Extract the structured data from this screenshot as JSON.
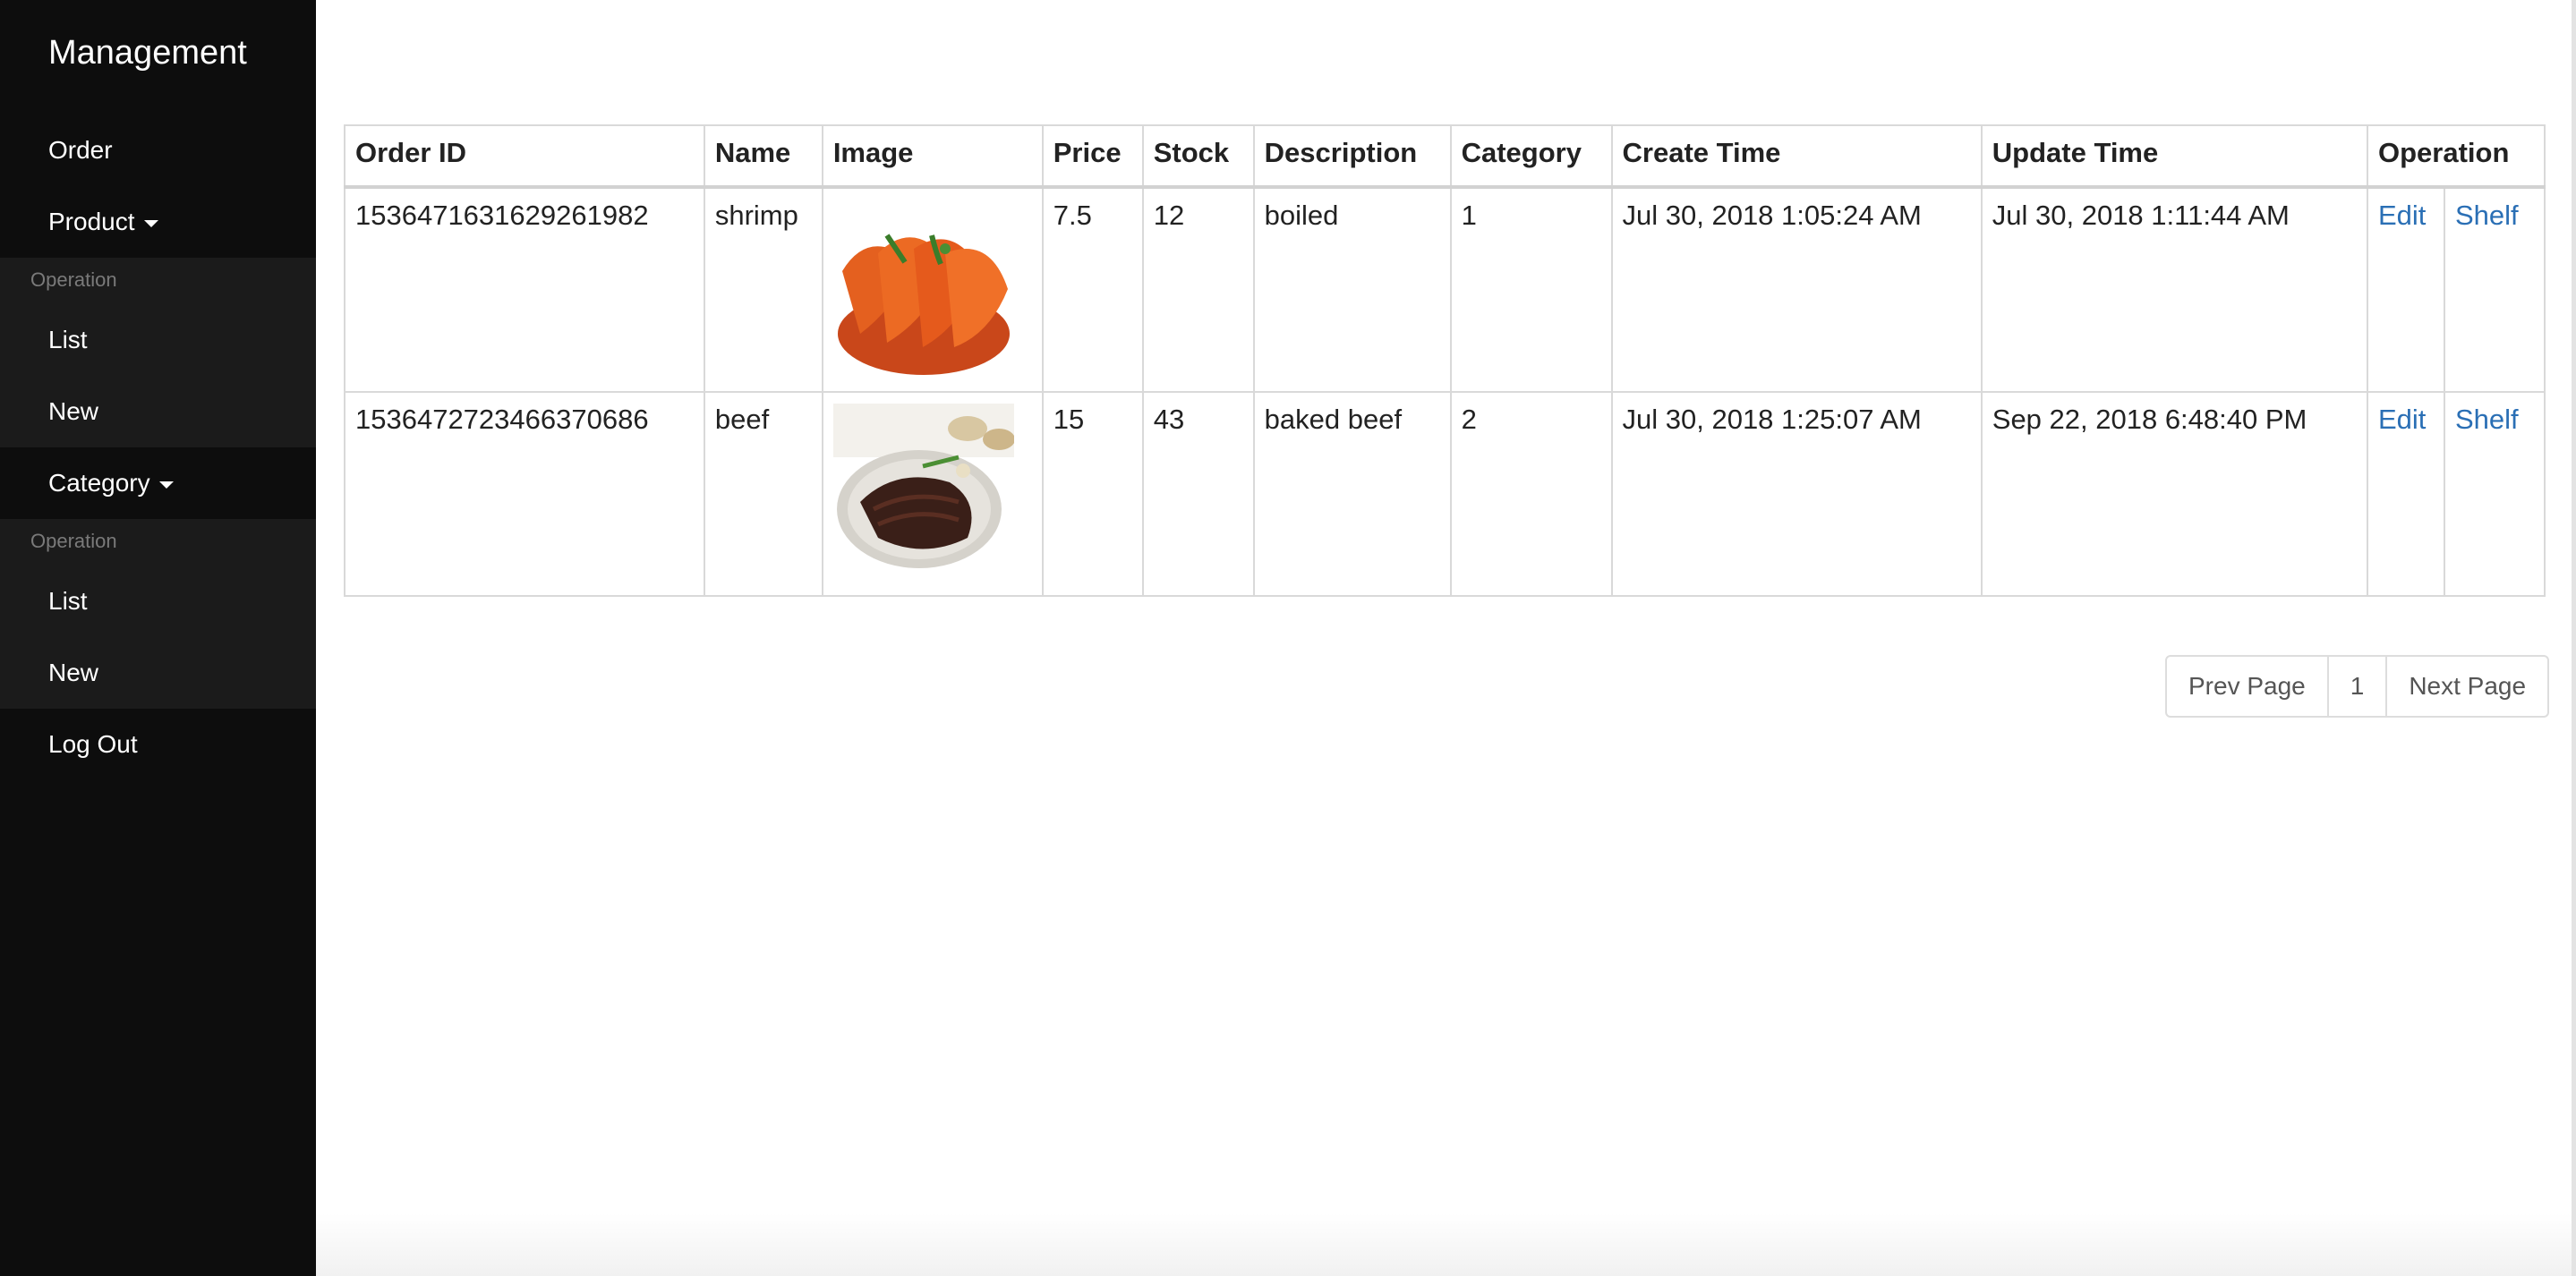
{
  "sidebar": {
    "brand": "Management",
    "order_label": "Order",
    "product": {
      "label": "Product",
      "section_header": "Operation",
      "items": [
        "List",
        "New"
      ]
    },
    "category": {
      "label": "Category",
      "section_header": "Operation",
      "items": [
        "List",
        "New"
      ]
    },
    "logout_label": "Log Out",
    "colors": {
      "background": "#0d0d0d",
      "submenu": "#1b1b1b"
    }
  },
  "table": {
    "headers": [
      "Order ID",
      "Name",
      "Image",
      "Price",
      "Stock",
      "Description",
      "Category",
      "Create Time",
      "Update Time",
      "Operation"
    ],
    "rows": [
      {
        "order_id": "1536471631629261982",
        "name": "shrimp",
        "image_icon": "shrimp-photo",
        "price": "7.5",
        "stock": "12",
        "description": "boiled",
        "category": "1",
        "create_time": "Jul 30, 2018 1:05:24 AM",
        "update_time": "Jul 30, 2018 1:11:44 AM",
        "edit": "Edit",
        "shelf": "Shelf"
      },
      {
        "order_id": "1536472723466370686",
        "name": "beef",
        "image_icon": "beef-photo",
        "price": "15",
        "stock": "43",
        "description": "baked beef",
        "category": "2",
        "create_time": "Jul 30, 2018 1:25:07 AM",
        "update_time": "Sep 22, 2018 6:48:40 PM",
        "edit": "Edit",
        "shelf": "Shelf"
      }
    ]
  },
  "pagination": {
    "prev": "Prev Page",
    "current": "1",
    "next": "Next Page"
  },
  "colors": {
    "link": "#2a6fb5",
    "border": "#d9d9d9"
  }
}
